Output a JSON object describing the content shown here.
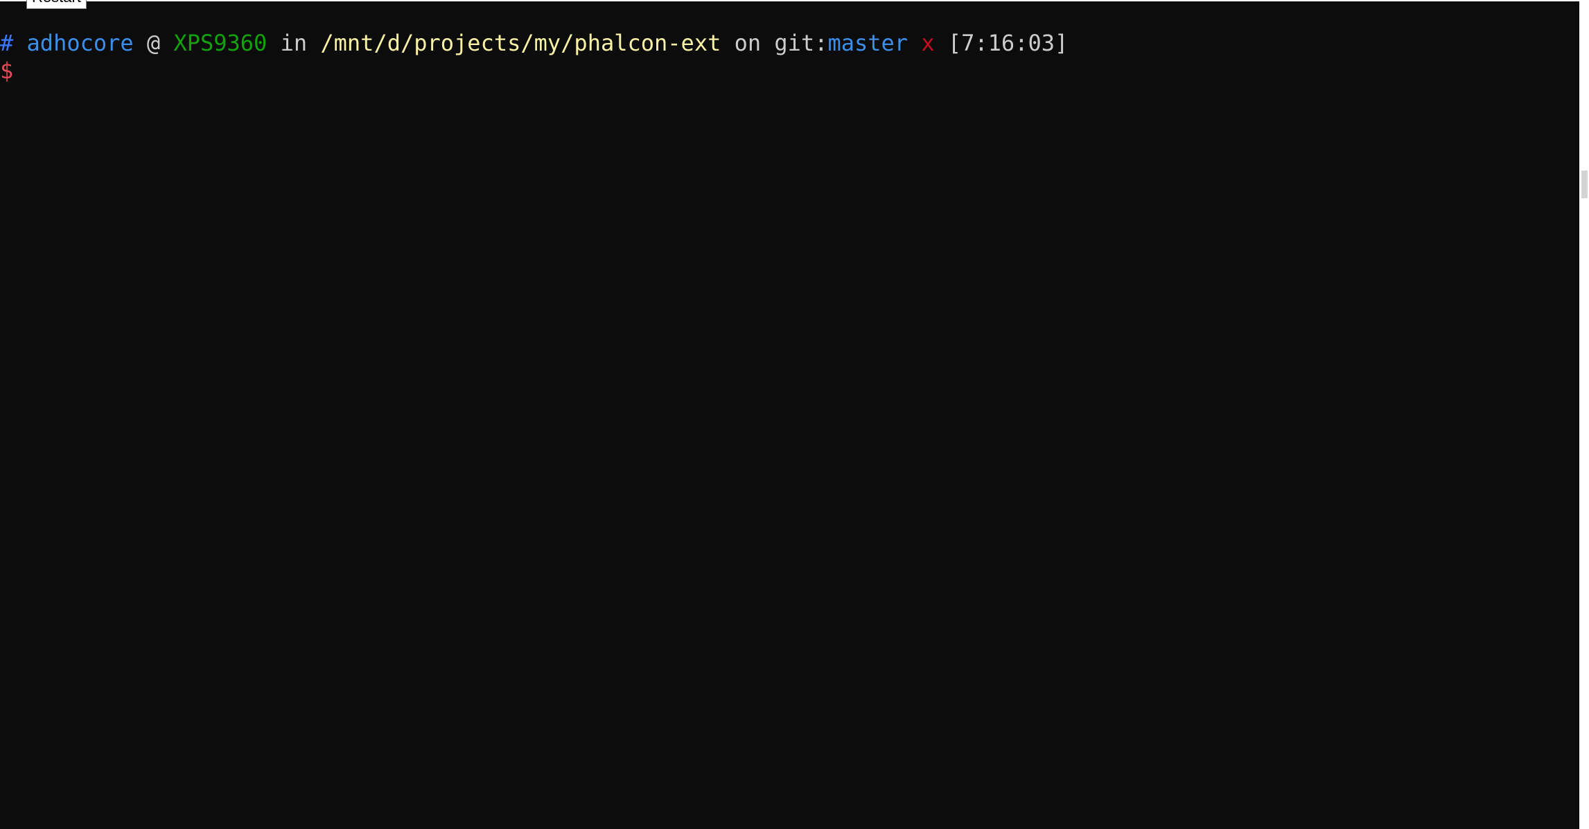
{
  "tooltip": {
    "label": "Restart"
  },
  "prompt": {
    "hash": "#",
    "user": "adhocore",
    "at": "@",
    "host": "XPS9360",
    "in_word": "in",
    "path": "/mnt/d/projects/my/phalcon-ext",
    "on_word": "on",
    "git_label": "git:",
    "branch": "master",
    "dirty_mark": "x",
    "time": "[7:16:03]",
    "symbol": "$"
  },
  "colors": {
    "background": "#0c0c0c",
    "default_text": "#cccccc",
    "hash": "#3b78ff",
    "user": "#3b8eea",
    "host": "#13a10e",
    "path": "#f9f1a5",
    "branch": "#3b8eea",
    "dirty_mark": "#c50f1f",
    "symbol": "#e74856"
  }
}
